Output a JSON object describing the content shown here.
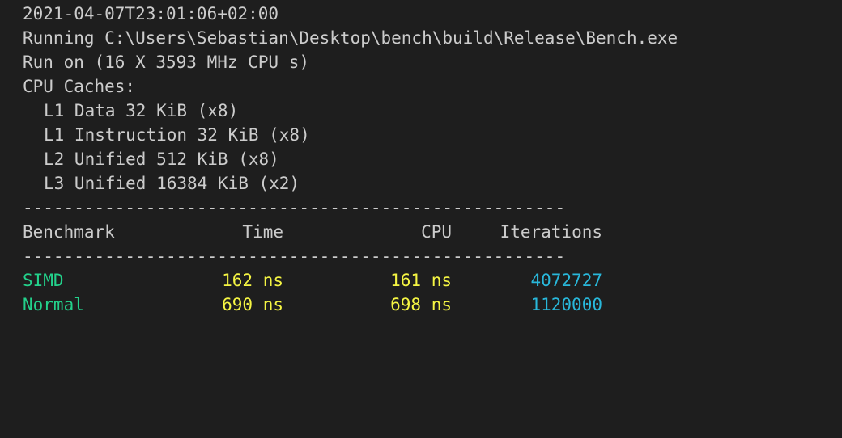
{
  "terminal": {
    "timestamp": "2021-04-07T23:01:06+02:00",
    "running_line": "Running C:\\Users\\Sebastian\\Desktop\\bench\\build\\Release\\Bench.exe",
    "run_on_line": "Run on (16 X 3593 MHz CPU s)",
    "caches_header": "CPU Caches:",
    "caches": [
      "L1 Data 32 KiB (x8)",
      "L1 Instruction 32 KiB (x8)",
      "L2 Unified 512 KiB (x8)",
      "L3 Unified 16384 KiB (x2)"
    ],
    "separator": "-----------------------------------------------------",
    "table": {
      "headers": {
        "benchmark": "Benchmark",
        "time": "Time",
        "cpu": "CPU",
        "iterations": "Iterations"
      },
      "rows": [
        {
          "benchmark": "SIMD",
          "time": "162 ns",
          "cpu": "161 ns",
          "iterations": "4072727"
        },
        {
          "benchmark": "Normal",
          "time": "690 ns",
          "cpu": "698 ns",
          "iterations": "1120000"
        }
      ]
    }
  },
  "colors": {
    "background": "#1e1e1e",
    "text": "#cccccc",
    "benchmark_name": "#23d18b",
    "time_values": "#f5f543",
    "iterations": "#29b8db"
  }
}
